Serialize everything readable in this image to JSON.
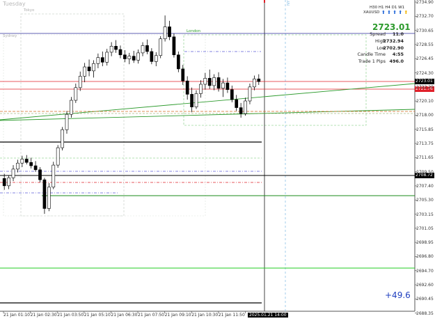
{
  "session_labels": {
    "day": "Tuesday",
    "tokyo": "Tokyo",
    "london": "London",
    "sydney": "Sydney",
    "ny": "NY"
  },
  "top_right": {
    "symbol": "XAUUSD",
    "timeframes": [
      "H30",
      "H1",
      "H4",
      "D1",
      "W1"
    ],
    "price": "2723.01",
    "info": [
      {
        "label": "Spread",
        "value": "11.0"
      },
      {
        "label": "High",
        "value": "2732.94"
      },
      {
        "label": "Low",
        "value": "2702.90"
      },
      {
        "label": "Candle Time",
        "value": "4:55"
      },
      {
        "label": "Trade 1 Pips",
        "value": "496.0"
      }
    ]
  },
  "pnl": "+49.6",
  "price_axis": [
    "2734.90",
    "2732.70",
    "2730.65",
    "2728.55",
    "2726.45",
    "2724.30",
    "2722.20",
    "2720.10",
    "2718.00",
    "2715.85",
    "2713.75",
    "2711.65",
    "2709.50",
    "2707.40",
    "2705.30",
    "2703.15",
    "2701.05",
    "2698.95",
    "2696.80",
    "2694.70",
    "2692.60",
    "2690.45",
    "2688.35"
  ],
  "price_tags": [
    {
      "value": "2723.01",
      "color": "#000000"
    },
    {
      "value": "2721.76",
      "color": "#e0202a"
    },
    {
      "value": "2708.72",
      "color": "#000000"
    }
  ],
  "time_axis": [
    "21 Jan 01:10",
    "21 Jan 02:30",
    "21 Jan 03:50",
    "21 Jan 05:10",
    "21 Jan 06:30",
    "21 Jan 07:50",
    "21 Jan 09:10",
    "21 Jan 10:30",
    "21 Jan 11:50",
    "2025.01.21 14:00"
  ],
  "chart_data": {
    "type": "candlestick",
    "ylim": [
      2688.35,
      2734.9
    ],
    "current_price": 2723.01,
    "high": 2732.94,
    "low": 2702.9,
    "candles": [
      [
        2708.5,
        2709.2,
        2706.8,
        2707.4
      ],
      [
        2707.4,
        2708.9,
        2706.9,
        2708.6
      ],
      [
        2708.6,
        2710.5,
        2708.1,
        2709.9
      ],
      [
        2709.9,
        2711.3,
        2709.4,
        2710.8
      ],
      [
        2710.8,
        2711.9,
        2710.2,
        2711.4
      ],
      [
        2711.4,
        2712.0,
        2710.6,
        2710.9
      ],
      [
        2710.9,
        2711.6,
        2710.0,
        2710.4
      ],
      [
        2710.4,
        2711.1,
        2709.5,
        2709.8
      ],
      [
        2709.8,
        2710.2,
        2707.9,
        2708.3
      ],
      [
        2708.3,
        2708.6,
        2703.2,
        2704.0
      ],
      [
        2704.0,
        2707.8,
        2703.6,
        2707.2
      ],
      [
        2707.2,
        2711.0,
        2706.9,
        2710.5
      ],
      [
        2710.5,
        2713.5,
        2710.1,
        2713.1
      ],
      [
        2713.1,
        2716.2,
        2712.7,
        2715.8
      ],
      [
        2715.8,
        2718.6,
        2715.2,
        2718.1
      ],
      [
        2718.1,
        2720.7,
        2717.6,
        2720.2
      ],
      [
        2720.2,
        2722.7,
        2719.8,
        2722.1
      ],
      [
        2722.1,
        2724.5,
        2721.6,
        2723.8
      ],
      [
        2723.8,
        2725.8,
        2722.9,
        2725.2
      ],
      [
        2725.2,
        2726.3,
        2723.8,
        2724.6
      ],
      [
        2724.6,
        2726.2,
        2723.6,
        2725.7
      ],
      [
        2725.7,
        2727.2,
        2725.0,
        2726.6
      ],
      [
        2726.6,
        2727.5,
        2725.3,
        2725.9
      ],
      [
        2725.9,
        2727.9,
        2725.4,
        2727.4
      ],
      [
        2727.4,
        2728.9,
        2726.8,
        2728.3
      ],
      [
        2728.3,
        2729.2,
        2727.3,
        2727.8
      ],
      [
        2727.8,
        2728.4,
        2726.5,
        2727.0
      ],
      [
        2727.0,
        2727.7,
        2725.9,
        2726.4
      ],
      [
        2726.4,
        2727.3,
        2725.6,
        2726.8
      ],
      [
        2726.8,
        2727.6,
        2725.8,
        2726.2
      ],
      [
        2726.2,
        2727.8,
        2725.7,
        2727.3
      ],
      [
        2727.3,
        2728.9,
        2726.8,
        2728.4
      ],
      [
        2728.4,
        2729.3,
        2727.1,
        2727.5
      ],
      [
        2727.5,
        2728.0,
        2725.6,
        2726.0
      ],
      [
        2726.0,
        2727.4,
        2725.3,
        2726.9
      ],
      [
        2726.9,
        2729.8,
        2726.5,
        2729.4
      ],
      [
        2729.4,
        2732.9,
        2729.0,
        2731.2
      ],
      [
        2731.2,
        2732.1,
        2729.2,
        2729.7
      ],
      [
        2729.7,
        2730.2,
        2726.6,
        2727.0
      ],
      [
        2727.0,
        2727.5,
        2724.4,
        2724.9
      ],
      [
        2724.9,
        2725.5,
        2722.5,
        2723.1
      ],
      [
        2723.1,
        2723.8,
        2720.3,
        2721.1
      ],
      [
        2721.1,
        2722.1,
        2718.4,
        2719.2
      ],
      [
        2719.2,
        2721.7,
        2718.9,
        2721.2
      ],
      [
        2721.2,
        2723.2,
        2720.6,
        2722.6
      ],
      [
        2722.6,
        2724.3,
        2721.8,
        2723.5
      ],
      [
        2723.5,
        2724.8,
        2721.9,
        2722.4
      ],
      [
        2722.4,
        2724.1,
        2721.7,
        2723.6
      ],
      [
        2723.6,
        2724.4,
        2721.5,
        2722.0
      ],
      [
        2722.0,
        2723.4,
        2720.7,
        2722.8
      ],
      [
        2722.8,
        2723.6,
        2721.3,
        2721.8
      ],
      [
        2721.8,
        2722.4,
        2719.9,
        2720.3
      ],
      [
        2720.3,
        2721.0,
        2718.6,
        2719.1
      ],
      [
        2719.1,
        2719.8,
        2717.6,
        2718.2
      ],
      [
        2718.2,
        2720.6,
        2717.9,
        2720.1
      ],
      [
        2720.1,
        2722.7,
        2719.6,
        2722.2
      ],
      [
        2722.2,
        2723.9,
        2721.7,
        2723.4
      ],
      [
        2723.4,
        2724.1,
        2722.5,
        2723.0
      ]
    ]
  }
}
